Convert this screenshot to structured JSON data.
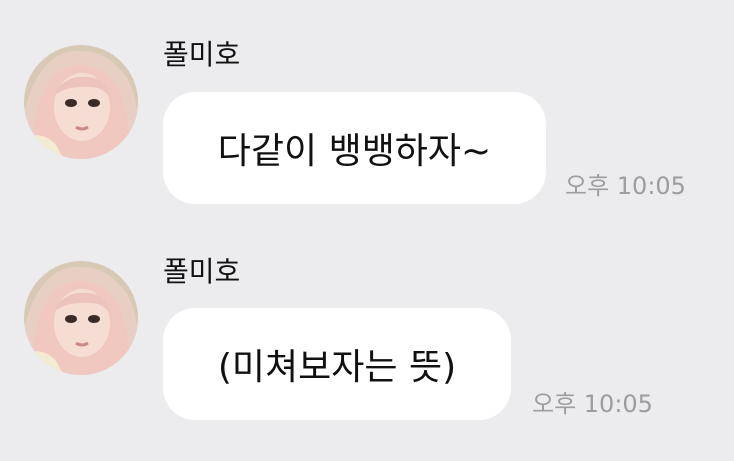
{
  "messages": [
    {
      "sender": "폴미호",
      "text": "다같이 뱅뱅하자~",
      "time": "오후 10:05"
    },
    {
      "sender": "폴미호",
      "text": "(미쳐보자는 뜻)",
      "time": "오후 10:05"
    }
  ],
  "colors": {
    "background": "#ececee",
    "bubble": "#ffffff",
    "timestamp": "#9c9ca1"
  }
}
